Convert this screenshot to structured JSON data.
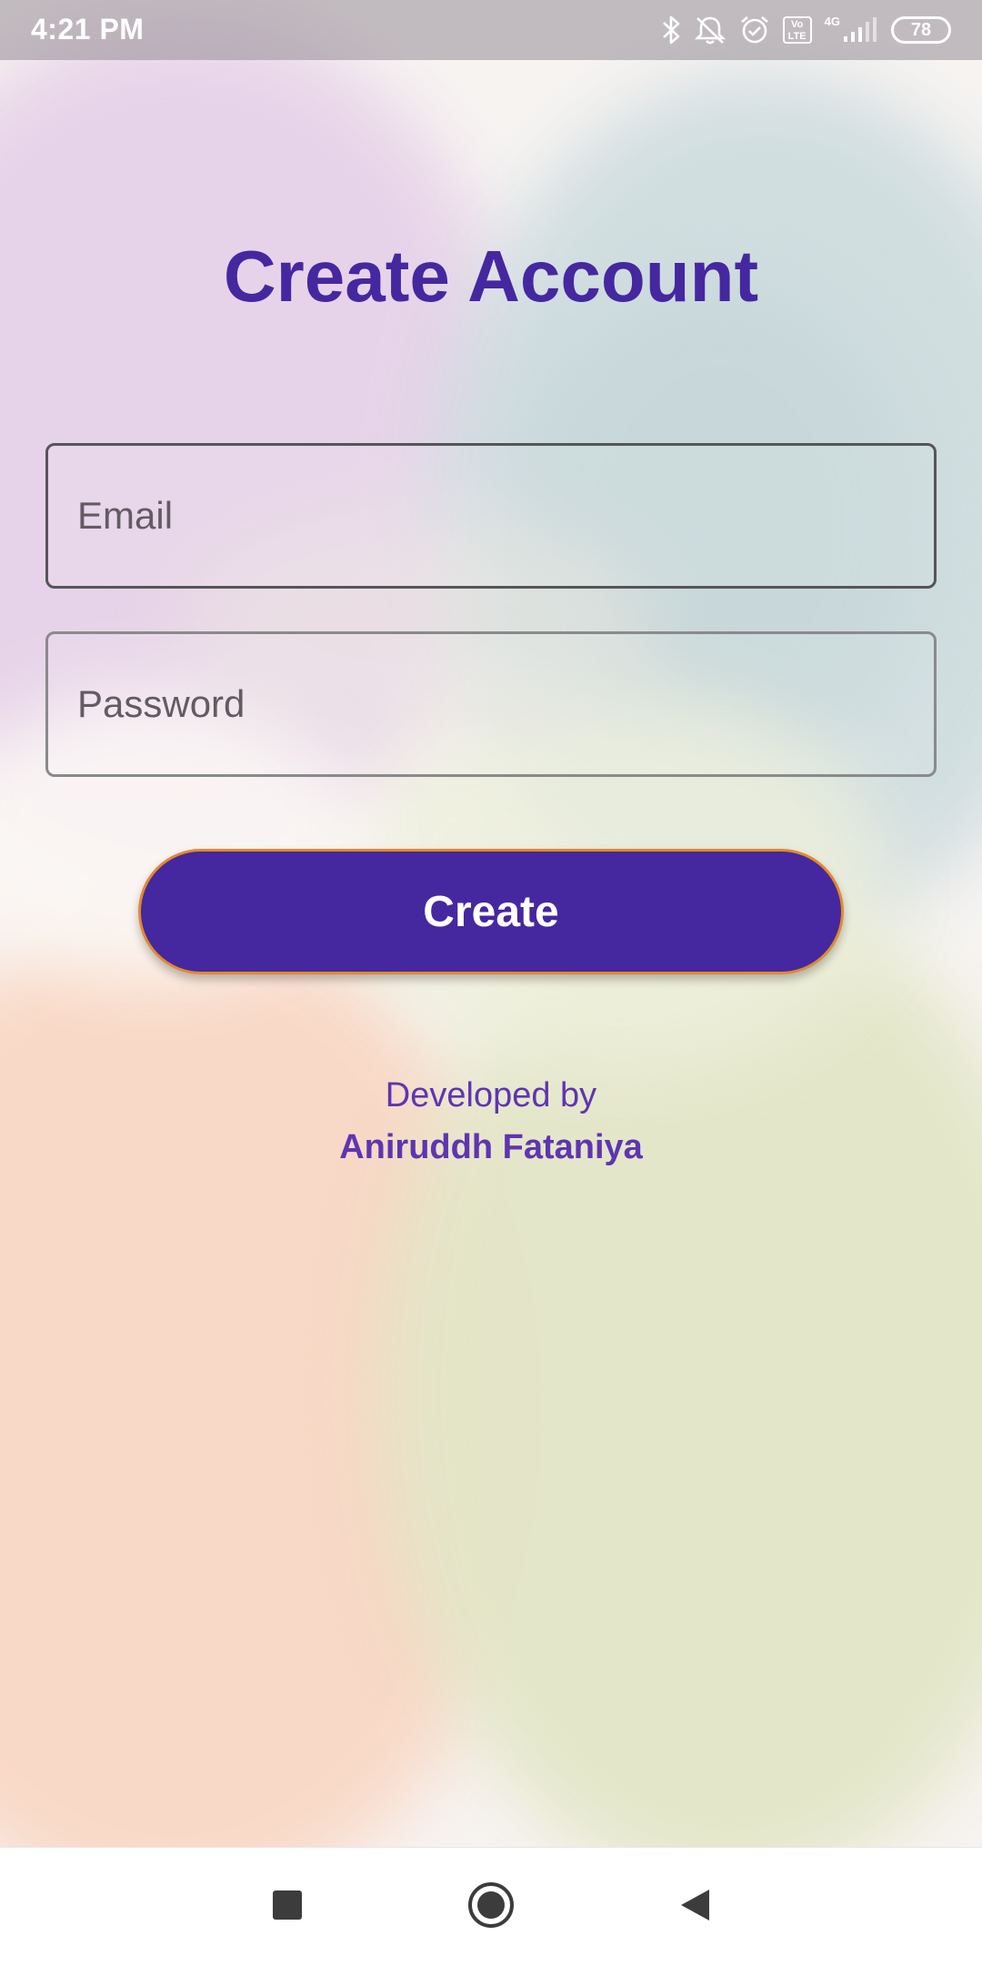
{
  "status_bar": {
    "time": "4:21 PM",
    "network_type": "4G",
    "volte_label": "Vo\nLTE",
    "battery_level": "78",
    "icons": [
      "bluetooth-icon",
      "mute-icon",
      "alarm-icon",
      "volte-icon",
      "signal-icon",
      "battery-icon"
    ]
  },
  "page": {
    "title": "Create Account"
  },
  "form": {
    "email_placeholder": "Email",
    "email_value": "",
    "password_placeholder": "Password",
    "password_value": "",
    "create_label": "Create"
  },
  "credit": {
    "line1": "Developed by",
    "line2": "Aniruddh Fataniya"
  },
  "nav_bar": {
    "icons": [
      "recents-icon",
      "home-icon",
      "back-icon"
    ]
  },
  "colors": {
    "accent": "#4527a0",
    "credit_text": "#5e35b1",
    "button_border": "#e08a2c"
  }
}
